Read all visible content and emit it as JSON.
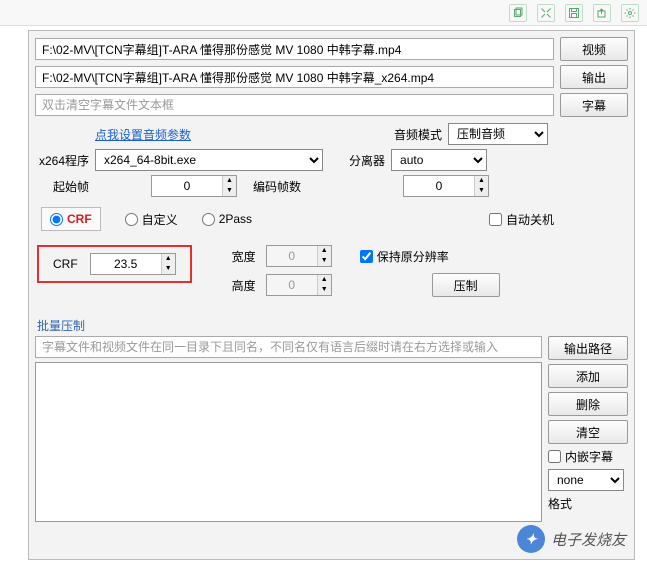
{
  "toolbar_icons": [
    "copy",
    "expand",
    "save",
    "share",
    "settings"
  ],
  "video_path": "F:\\02-MV\\[TCN字幕组]T-ARA 懂得那份感觉 MV 1080 中韩字幕.mp4",
  "output_path": "F:\\02-MV\\[TCN字幕组]T-ARA 懂得那份感觉 MV 1080 中韩字幕_x264.mp4",
  "subtitle_placeholder": "双击清空字幕文件文本框",
  "btn_video": "视频",
  "btn_output": "输出",
  "btn_subtitle": "字幕",
  "btn_encode": "压制",
  "btn_output_path": "输出路径",
  "btn_add": "添加",
  "btn_delete": "删除",
  "btn_clear": "清空",
  "link_audio_params": "点我设置音频参数",
  "label_audio_mode": "音频模式",
  "audio_mode_value": "压制音频",
  "label_x264": "x264程序",
  "x264_value": "x264_64-8bit.exe",
  "label_demuxer": "分离器",
  "demuxer_value": "auto",
  "label_start_frame": "起始帧",
  "start_frame_value": "0",
  "label_frame_count": "编码帧数",
  "frame_count_value": "0",
  "mode_crf": "CRF",
  "mode_custom": "自定义",
  "mode_2pass": "2Pass",
  "chk_auto_shutdown": "自动关机",
  "label_crf": "CRF",
  "crf_value": "23.5",
  "label_width": "宽度",
  "width_value": "0",
  "label_height": "高度",
  "height_value": "0",
  "chk_keep_res": "保持原分辨率",
  "section_batch": "批量压制",
  "batch_placeholder": "字幕文件和视频文件在同一目录下且同名，不同名仅有语言后缀时请在右方选择或输入",
  "chk_embed_sub": "内嵌字幕",
  "sub_select_value": "none",
  "label_format": "格式",
  "watermark_text": "电子发烧友"
}
